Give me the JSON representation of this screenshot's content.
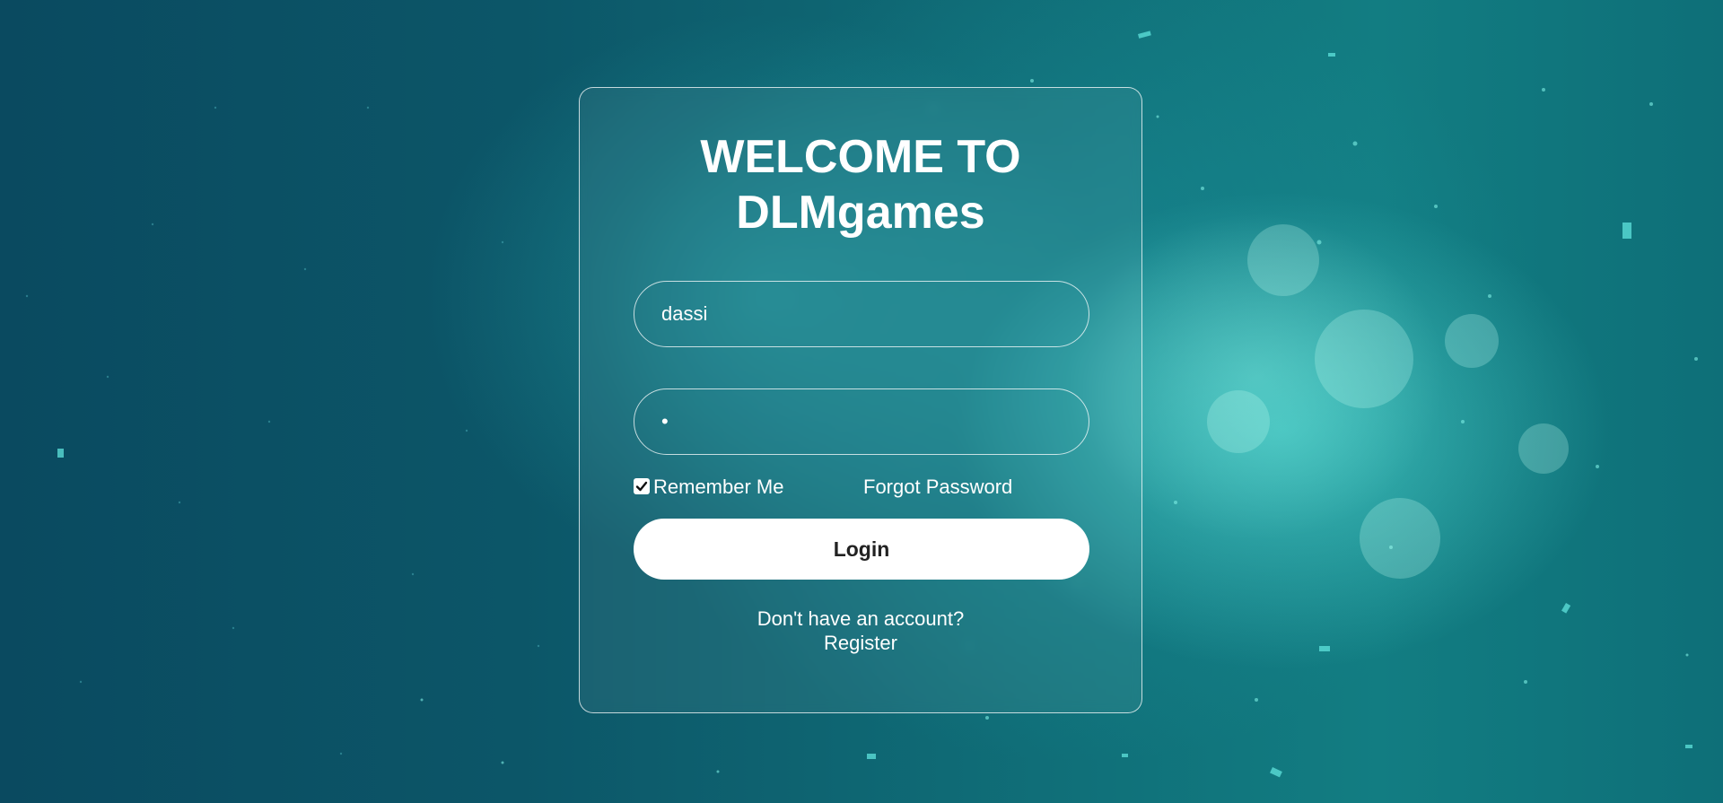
{
  "login": {
    "title_line1": "WELCOME TO",
    "title_line2": "DLMgames",
    "username_value": "dassi",
    "password_value": "•",
    "remember_label": "Remember Me",
    "remember_checked": true,
    "forgot_label": "Forgot Password",
    "login_label": "Login",
    "no_account_text": "Don't have an account?",
    "register_label": "Register"
  },
  "colors": {
    "background_dark": "#0a4a60",
    "background_glow": "#5febe1",
    "button_bg": "#ffffff",
    "button_text": "#222222",
    "text": "#ffffff"
  },
  "icons": {
    "checkbox": "check-icon"
  }
}
